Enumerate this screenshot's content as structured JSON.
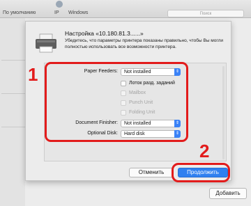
{
  "background": {
    "tabs": [
      "По умолчанию",
      "IP",
      "Windows"
    ],
    "search_placeholder": "Поиск",
    "add_button": "Добавить"
  },
  "dialog": {
    "title": "Настройка «10.180.81.3......»",
    "description": "Убедитесь, что параметры принтера показаны правильно, чтобы Вы могли полностью использовать все возможности принтера.",
    "paper_feeders_label": "Paper Feeders:",
    "paper_feeders_value": "Not installed",
    "options": [
      {
        "label": "Лоток разд. заданий",
        "checked": false,
        "enabled": true
      },
      {
        "label": "Mailbox",
        "checked": false,
        "enabled": false
      },
      {
        "label": "Punch Unit",
        "checked": false,
        "enabled": false
      },
      {
        "label": "Folding Unit",
        "checked": false,
        "enabled": false
      }
    ],
    "document_finisher_label": "Document Finisher:",
    "document_finisher_value": "Not installed",
    "optional_disk_label": "Optional Disk:",
    "optional_disk_value": "Hard disk",
    "cancel_button": "Отменить",
    "continue_button": "Продолжить"
  },
  "annotations": {
    "step1": "1",
    "step2": "2",
    "color": "#e21b1b"
  },
  "colors": {
    "accent": "#2f80f0",
    "select_arrow": "#3b82f6"
  }
}
